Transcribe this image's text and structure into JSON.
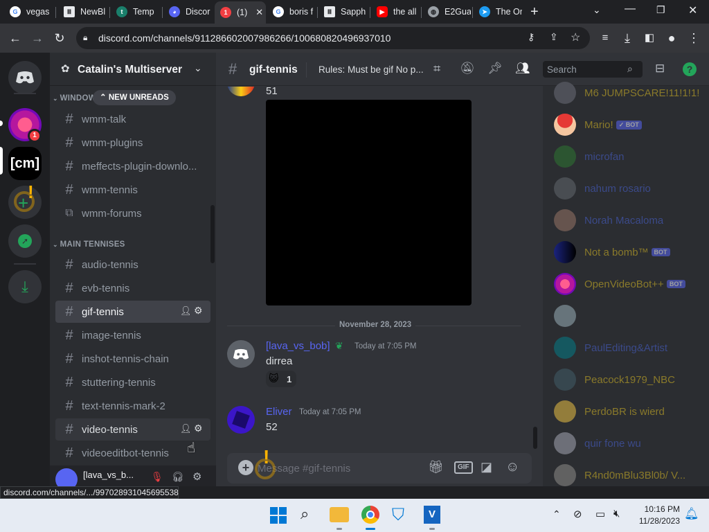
{
  "browser": {
    "tabs": [
      {
        "label": "vegas",
        "icon": "google-icon"
      },
      {
        "label": "NewBl",
        "icon": "museum-icon"
      },
      {
        "label": "Temp",
        "icon": "temp-icon"
      },
      {
        "label": "Discor",
        "icon": "discord-icon"
      },
      {
        "label": "(1)",
        "icon": "discord-notify-icon"
      },
      {
        "label": "boris f",
        "icon": "google-icon"
      },
      {
        "label": "Sapph",
        "icon": "museum-icon"
      },
      {
        "label": "the all",
        "icon": "youtube-icon"
      },
      {
        "label": "E2Gua",
        "icon": "globe-icon"
      },
      {
        "label": "The Or",
        "icon": "bird-icon"
      }
    ],
    "url": "discord.com/channels/911286602007986266/1006808204969370​10",
    "status_url": "discord.com/channels/.../997028931045695538"
  },
  "server": {
    "name": "Catalin's Multiserver",
    "categories": [
      {
        "label": "WINDOW",
        "new_unreads": "NEW UNREADS"
      },
      {
        "label": "MAIN TENNISES"
      }
    ],
    "channels_top": [
      {
        "label": "wmm-talk",
        "type": "text"
      },
      {
        "label": "wmm-plugins",
        "type": "text"
      },
      {
        "label": "meffects-plugin-downlo...",
        "type": "text"
      },
      {
        "label": "wmm-tennis",
        "type": "text"
      },
      {
        "label": "wmm-forums",
        "type": "forum"
      }
    ],
    "channels_main": [
      {
        "label": "audio-tennis"
      },
      {
        "label": "evb-tennis"
      },
      {
        "label": "gif-tennis"
      },
      {
        "label": "image-tennis"
      },
      {
        "label": "inshot-tennis-chain"
      },
      {
        "label": "stuttering-tennis"
      },
      {
        "label": "text-tennis-mark-2"
      },
      {
        "label": "video-tennis"
      },
      {
        "label": "videoeditbot-tennis"
      }
    ],
    "user_panel_name": "[lava_vs_b..."
  },
  "chat": {
    "channel": "gif-tennis",
    "topic": "Rules: Must be gif No p...",
    "search_placeholder": "Search",
    "messages": [
      {
        "content": "51"
      },
      {
        "date_divider": "November 28, 2023"
      },
      {
        "author": "[lava_vs_bob]",
        "timestamp": "Today at 7:05 PM",
        "content": "dirrea",
        "reaction_count": "1"
      },
      {
        "author": "Eliver",
        "timestamp": "Today at 7:05 PM",
        "content": "52"
      }
    ],
    "composer_placeholder": "Message #gif-tennis",
    "gif_label": "GIF"
  },
  "members": [
    {
      "name": "M6 JUMPSCARE!11!1!1!",
      "color": "#8a7a2a"
    },
    {
      "name": "Mario!",
      "color": "#8a7a2a",
      "bot": "✓ BOT"
    },
    {
      "name": "microfan",
      "color": "#3b4a8a"
    },
    {
      "name": "nahum rosario",
      "color": "#3b4a8a"
    },
    {
      "name": "Norah Macaloma",
      "color": "#3b4a8a"
    },
    {
      "name": "Not a bomb™",
      "color": "#8a7a2a",
      "bot": "BOT"
    },
    {
      "name": "OpenVideoBot++",
      "color": "#8a7a2a",
      "bot": "BOT"
    },
    {
      "name": "",
      "color": "#6a2a2a"
    },
    {
      "name": "PaulEditing&Artist",
      "color": "#3b4a8a"
    },
    {
      "name": "Peacock1979_NBC",
      "color": "#8a7a2a"
    },
    {
      "name": "PerdoBR is wierd",
      "color": "#8a7a2a"
    },
    {
      "name": "quir fone wu",
      "color": "#3b4a8a"
    },
    {
      "name": "R4nd0mBlu3Bl0b/ V...",
      "color": "#8a7a2a"
    }
  ],
  "taskbar": {
    "time": "10:16 PM",
    "date": "11/28/2023"
  },
  "colors": {
    "discord_blurple": "#5865f2",
    "online_green": "#23a55a",
    "badge_red": "#f23f43"
  }
}
